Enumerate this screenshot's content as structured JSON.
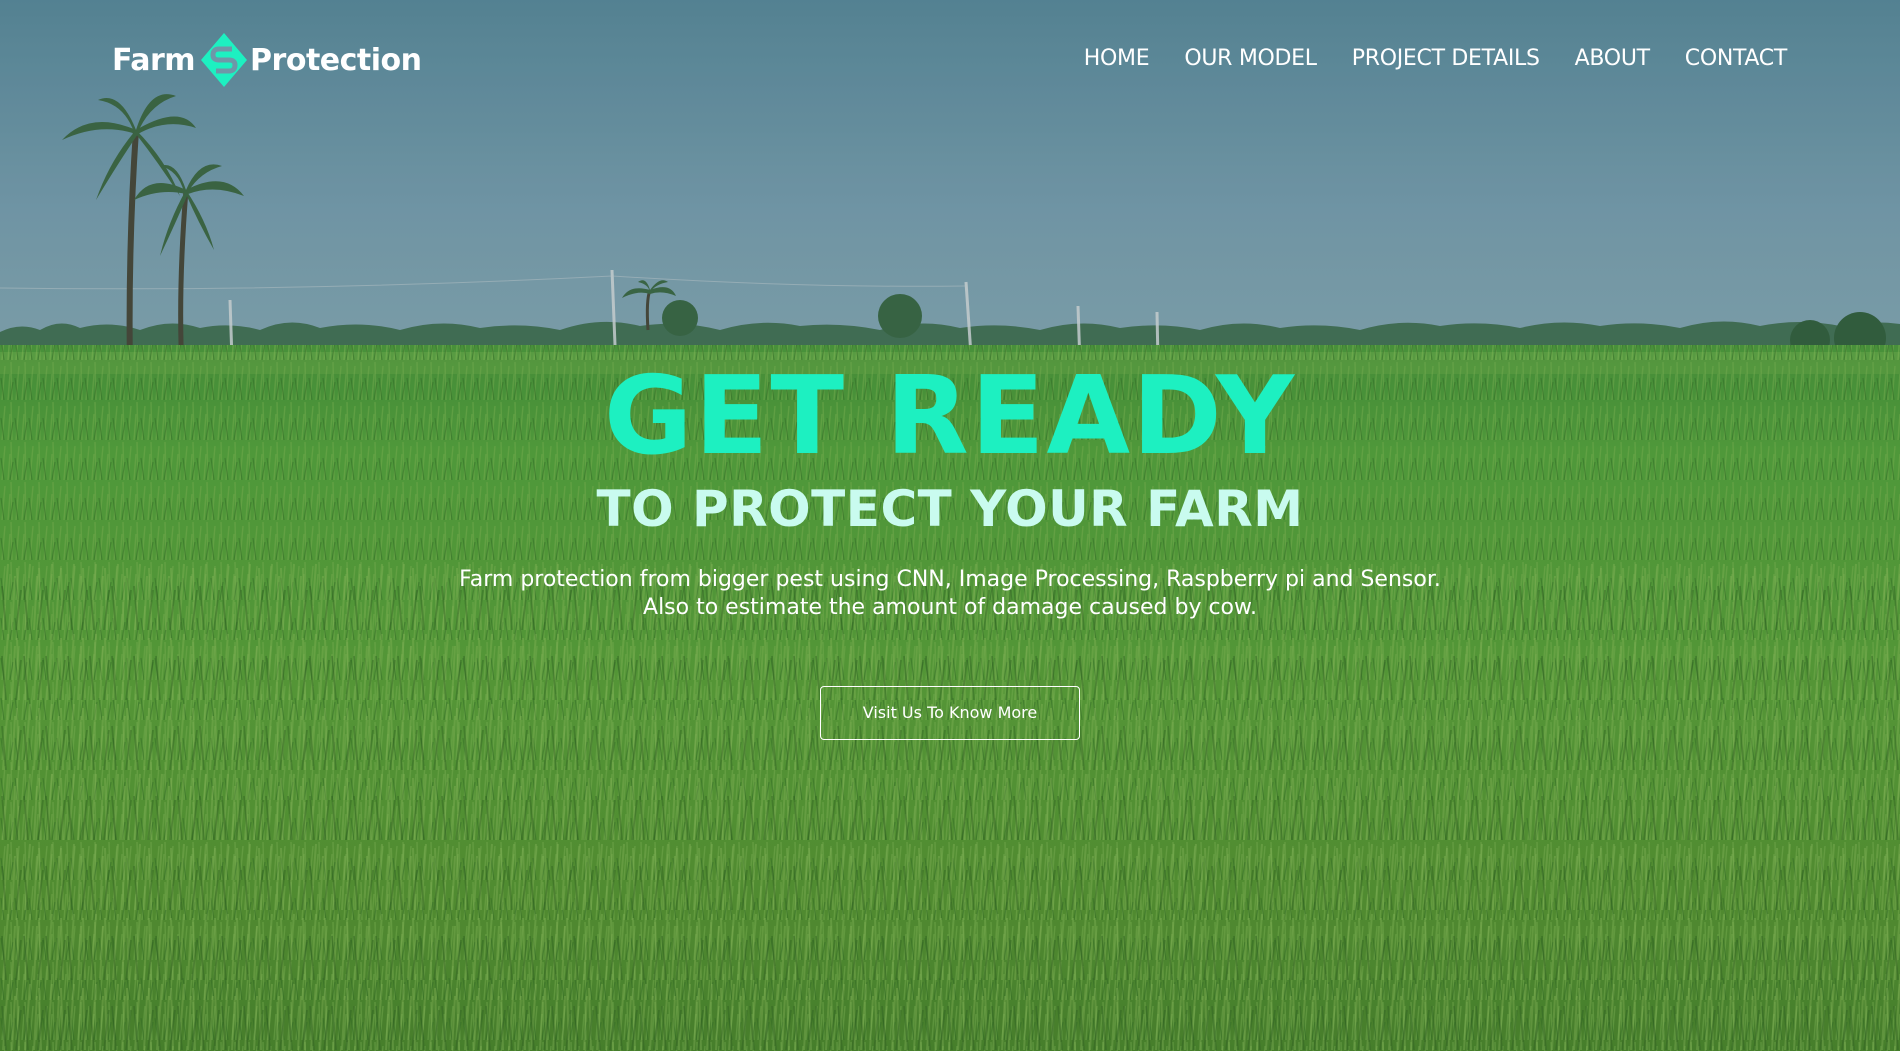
{
  "brand": {
    "word_left": "Farm",
    "word_right": "Protection",
    "icon": "diamond-s-logo-icon",
    "accent_color": "#1df0c1"
  },
  "nav": {
    "items": [
      {
        "label": "HOME"
      },
      {
        "label": "OUR MODEL"
      },
      {
        "label": "PROJECT DETAILS"
      },
      {
        "label": "ABOUT"
      },
      {
        "label": "CONTACT"
      }
    ]
  },
  "hero": {
    "headline": "GET READY",
    "subheadline": "TO PROTECT YOUR FARM",
    "description_line1": "Farm protection from bigger pest using CNN, Image Processing, Raspberry pi and Sensor.",
    "description_line2": "Also to estimate the amount of damage caused by cow.",
    "cta_label": "Visit Us To Know More",
    "headline_color": "#1df0c1",
    "subheadline_color": "#c9fbef"
  }
}
